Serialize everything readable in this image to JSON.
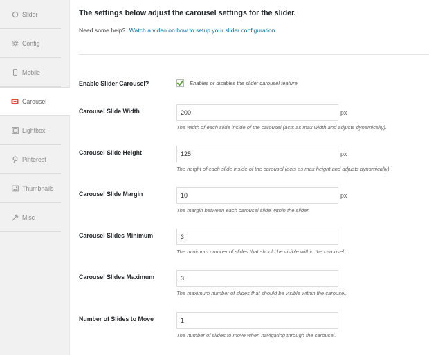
{
  "sidebar": {
    "tabs": [
      {
        "label": "Slider",
        "icon": "circle-icon"
      },
      {
        "label": "Config",
        "icon": "gear-icon"
      },
      {
        "label": "Mobile",
        "icon": "mobile-icon"
      },
      {
        "label": "Carousel",
        "icon": "carousel-icon"
      },
      {
        "label": "Lightbox",
        "icon": "lightbox-icon"
      },
      {
        "label": "Pinterest",
        "icon": "pinterest-icon"
      },
      {
        "label": "Thumbnails",
        "icon": "image-icon"
      },
      {
        "label": "Misc",
        "icon": "wrench-icon"
      }
    ],
    "active": "Carousel",
    "accent_color": "#e44c3a"
  },
  "main": {
    "title": "The settings below adjust the carousel settings for the slider.",
    "help_prefix": "Need some help?",
    "help_link": "Watch a video on how to setup your slider configuration",
    "link_color": "#0073aa",
    "enable": {
      "label": "Enable Slider Carousel?",
      "checked": true,
      "description": "Enables or disables the slider carousel feature.",
      "check_color": "#5aa332"
    },
    "fields": [
      {
        "label": "Carousel Slide Width",
        "value": "200",
        "unit": "px",
        "description": "The width of each slide inside of the carousel (acts as max width and adjusts dynamically)."
      },
      {
        "label": "Carousel Slide Height",
        "value": "125",
        "unit": "px",
        "description": "The height of each slide inside of the carousel (acts as max height and adjusts dynamically)."
      },
      {
        "label": "Carousel Slide Margin",
        "value": "10",
        "unit": "px",
        "description": "The margin between each carousel slide within the slider."
      },
      {
        "label": "Carousel Slides Minimum",
        "value": "3",
        "unit": "",
        "description": "The minimum number of slides that should be visible within the carousel."
      },
      {
        "label": "Carousel Slides Maximum",
        "value": "3",
        "unit": "",
        "description": "The maximum number of slides that should be visible within the carousel."
      },
      {
        "label": "Number of Slides to Move",
        "value": "1",
        "unit": "",
        "description": "The number of slides to move when navigating through the carousel."
      }
    ]
  }
}
